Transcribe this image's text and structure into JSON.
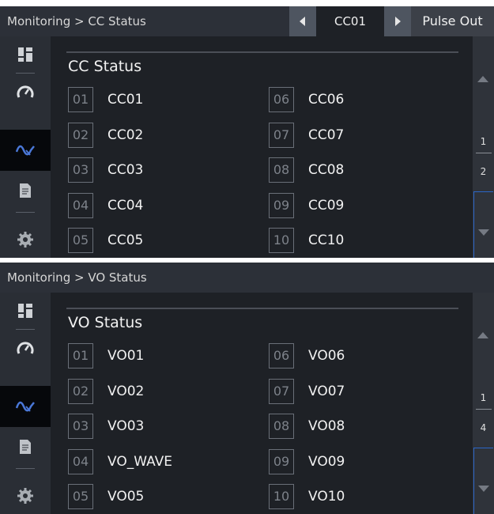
{
  "panel1": {
    "breadcrumb": "Monitoring > CC Status",
    "selector_value": "CC01",
    "pulse_button": "Pulse Out",
    "title": "CC Status",
    "items_left": [
      {
        "num": "01",
        "label": "CC01"
      },
      {
        "num": "02",
        "label": "CC02"
      },
      {
        "num": "03",
        "label": "CC03"
      },
      {
        "num": "04",
        "label": "CC04"
      },
      {
        "num": "05",
        "label": "CC05"
      }
    ],
    "items_right": [
      {
        "num": "06",
        "label": "CC06"
      },
      {
        "num": "07",
        "label": "CC07"
      },
      {
        "num": "08",
        "label": "CC08"
      },
      {
        "num": "09",
        "label": "CC09"
      },
      {
        "num": "10",
        "label": "CC10"
      }
    ],
    "page": {
      "current": "1",
      "total": "2"
    }
  },
  "panel2": {
    "breadcrumb": "Monitoring > VO Status",
    "title": "VO Status",
    "items_left": [
      {
        "num": "01",
        "label": "VO01"
      },
      {
        "num": "02",
        "label": "VO02"
      },
      {
        "num": "03",
        "label": "VO03"
      },
      {
        "num": "04",
        "label": "VO_WAVE"
      },
      {
        "num": "05",
        "label": "VO05"
      }
    ],
    "items_right": [
      {
        "num": "06",
        "label": "VO06"
      },
      {
        "num": "07",
        "label": "VO07"
      },
      {
        "num": "08",
        "label": "VO08"
      },
      {
        "num": "09",
        "label": "VO09"
      },
      {
        "num": "10",
        "label": "VO10"
      }
    ],
    "page": {
      "current": "1",
      "total": "4"
    }
  },
  "sidebar_icons": [
    "dashboard-icon",
    "gauge-icon",
    "waveform-icon",
    "document-icon",
    "settings-gear-icon"
  ],
  "colors": {
    "background": "#1e2126",
    "header": "#2c3038",
    "sidebar": "#2a2e35",
    "active": "#06080b",
    "accent": "#2b66c7",
    "wave_icon": "#4a78d8"
  }
}
